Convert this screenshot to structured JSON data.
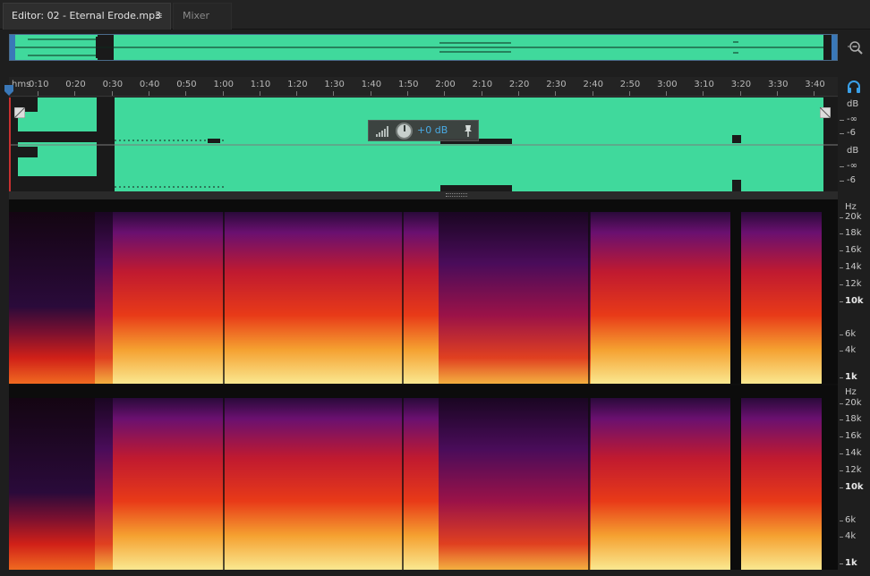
{
  "tabs": {
    "editor_label": "Editor: 02 - Eternal Erode.mp3",
    "editor_menu": "≡",
    "mixer_label": "Mixer"
  },
  "ruler": {
    "unit": "hms",
    "labels": [
      "0:10",
      "0:20",
      "0:30",
      "0:40",
      "0:50",
      "1:00",
      "1:10",
      "1:20",
      "1:30",
      "1:40",
      "1:50",
      "2:00",
      "2:10",
      "2:20",
      "2:30",
      "2:40",
      "2:50",
      "3:00",
      "3:10",
      "3:20",
      "3:30",
      "3:40"
    ]
  },
  "hud": {
    "volume_value": "+0 dB"
  },
  "amplitude_scale": {
    "unit": "dB",
    "top_ch": [
      "dB",
      "-∞",
      "-6"
    ],
    "bottom_ch": [
      "dB",
      "-∞",
      "-6"
    ]
  },
  "frequency_scale": {
    "unit": "Hz",
    "labels": [
      "20k",
      "18k",
      "16k",
      "14k",
      "12k",
      "10k",
      "6k",
      "4k",
      "1k"
    ]
  },
  "colors": {
    "waveform": "#40d99c",
    "playhead": "#3a78b8",
    "hud_value": "#4aa8e8"
  }
}
